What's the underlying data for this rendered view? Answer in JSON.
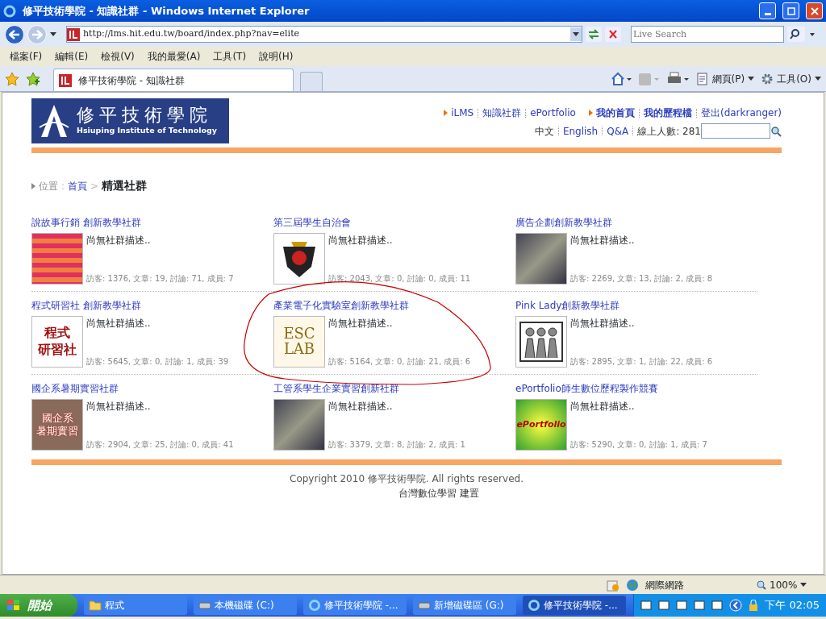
{
  "window": {
    "title": "修平技術學院 - 知識社群 - Windows Internet Explorer"
  },
  "address_bar": {
    "url": "http://lms.hit.edu.tw/board/index.php?nav=elite",
    "search_placeholder": "Live Search"
  },
  "menu": [
    "檔案(F)",
    "編輯(E)",
    "檢視(V)",
    "我的最愛(A)",
    "工具(T)",
    "說明(H)"
  ],
  "tabs": [
    {
      "label": "修平技術學院 - 知識社群",
      "selected": true
    }
  ],
  "command_bar": [
    "網頁(P)",
    "工具(O)"
  ],
  "site": {
    "logo_title": "修平技術學院",
    "logo_subtitle": "Hsiuping Institute of Technology",
    "links_1": [
      "iLMS",
      "知識社群",
      "ePortfolio"
    ],
    "links_2": [
      "我的首頁",
      "我的歷程檔",
      "登出(darkranger)"
    ],
    "languages": [
      {
        "label": "中文",
        "selected": true
      },
      {
        "label": "English",
        "selected": false
      },
      {
        "label": "Q&A",
        "selected": false
      }
    ],
    "online": "線上人數: 281"
  },
  "breadcrumb": {
    "label": "位置",
    "separator": ":",
    "home": "首頁",
    "arrow": ">",
    "current": "精選社群"
  },
  "communities": [
    {
      "title": "說故事行銷 創新教學社群",
      "desc": "尚無社群描述..",
      "stats": "訪客: 1376, 文章: 19, 討論: 71, 成員: 7",
      "kind": "flowers"
    },
    {
      "title": "第三屆學生自治會",
      "desc": "尚無社群描述..",
      "stats": "訪客: 2043, 文章: 0, 討論: 0, 成員: 11",
      "kind": "crest"
    },
    {
      "title": "廣告企劃創新教學社群",
      "desc": "尚無社群描述..",
      "stats": "訪客: 2269, 文章: 13, 討論: 2, 成員: 8",
      "kind": "photo"
    },
    {
      "title": "程式研習社 創新教學社群",
      "desc": "尚無社群描述..",
      "stats": "訪客: 5645, 文章: 0, 討論: 1, 成員: 39",
      "kind": "text",
      "thumb_lines": [
        "程式",
        "研習社"
      ]
    },
    {
      "title": "產業電子化實驗室創新教學社群",
      "desc": "尚無社群描述..",
      "stats": "訪客: 5164, 文章: 0, 討論: 21, 成員: 6",
      "kind": "escl",
      "thumb_lines": [
        "ESC",
        "LAB"
      ]
    },
    {
      "title": "Pink Lady創新教學社群",
      "desc": "尚無社群描述..",
      "stats": "訪客: 2895, 文章: 1, 討論: 22, 成員: 6",
      "kind": "people"
    },
    {
      "title": "國企系暑期實習社群",
      "desc": "尚無社群描述..",
      "stats": "訪客: 2904, 文章: 25, 討論: 0, 成員: 41",
      "kind": "textphoto",
      "thumb_lines": [
        "國企系",
        "暑期實習"
      ]
    },
    {
      "title": "工管系學生企業實習創新社群",
      "desc": "尚無社群描述..",
      "stats": "訪客: 3379, 文章: 8, 討論: 2, 成員: 1",
      "kind": "photo"
    },
    {
      "title": "ePortfolio師生數位歷程製作競賽",
      "desc": "尚無社群描述..",
      "stats": "訪客: 5290, 文章: 0, 討論: 1, 成員: 7",
      "kind": "eport",
      "thumb_lines": [
        "ePortfolio"
      ]
    }
  ],
  "footer": {
    "copyright": "Copyright 2010 修平技術學院. All rights reserved.",
    "credit": "台灣數位學習 建置"
  },
  "status_bar": {
    "zone": "網際網路",
    "zoom": "100%"
  },
  "taskbar": {
    "start": "開始",
    "items": [
      {
        "label": "程式",
        "kind": "folder",
        "selected": false
      },
      {
        "label": "本機磁碟 (C:)",
        "kind": "drive",
        "selected": false
      },
      {
        "label": "修平技術學院 -...",
        "kind": "ie",
        "selected": false
      },
      {
        "label": "新增磁碟區 (G:)",
        "kind": "drive",
        "selected": false
      },
      {
        "label": "修平技術學院 -...",
        "kind": "ie",
        "selected": true
      }
    ],
    "clock": "下午 02:05"
  }
}
